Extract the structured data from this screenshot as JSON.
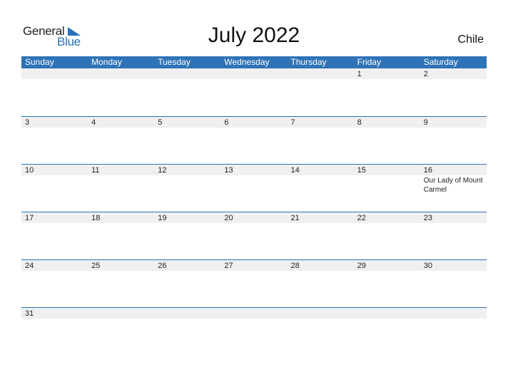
{
  "logo": {
    "line1": "General",
    "line2": "Blue"
  },
  "title": "July 2022",
  "country": "Chile",
  "colors": {
    "header_bg": "#2e73b6",
    "date_strip": "#f0f0f0",
    "logo_blue": "#2a71b8"
  },
  "weekdays": [
    "Sunday",
    "Monday",
    "Tuesday",
    "Wednesday",
    "Thursday",
    "Friday",
    "Saturday"
  ],
  "weeks": [
    {
      "days": [
        "",
        "",
        "",
        "",
        "",
        "1",
        "2"
      ],
      "events": [
        "",
        "",
        "",
        "",
        "",
        "",
        ""
      ]
    },
    {
      "days": [
        "3",
        "4",
        "5",
        "6",
        "7",
        "8",
        "9"
      ],
      "events": [
        "",
        "",
        "",
        "",
        "",
        "",
        ""
      ]
    },
    {
      "days": [
        "10",
        "11",
        "12",
        "13",
        "14",
        "15",
        "16"
      ],
      "events": [
        "",
        "",
        "",
        "",
        "",
        "",
        "Our Lady of Mount Carmel"
      ]
    },
    {
      "days": [
        "17",
        "18",
        "19",
        "20",
        "21",
        "22",
        "23"
      ],
      "events": [
        "",
        "",
        "",
        "",
        "",
        "",
        ""
      ]
    },
    {
      "days": [
        "24",
        "25",
        "26",
        "27",
        "28",
        "29",
        "30"
      ],
      "events": [
        "",
        "",
        "",
        "",
        "",
        "",
        ""
      ]
    },
    {
      "days": [
        "31",
        "",
        "",
        "",
        "",
        "",
        ""
      ],
      "events": [
        "",
        "",
        "",
        "",
        "",
        "",
        ""
      ]
    }
  ]
}
